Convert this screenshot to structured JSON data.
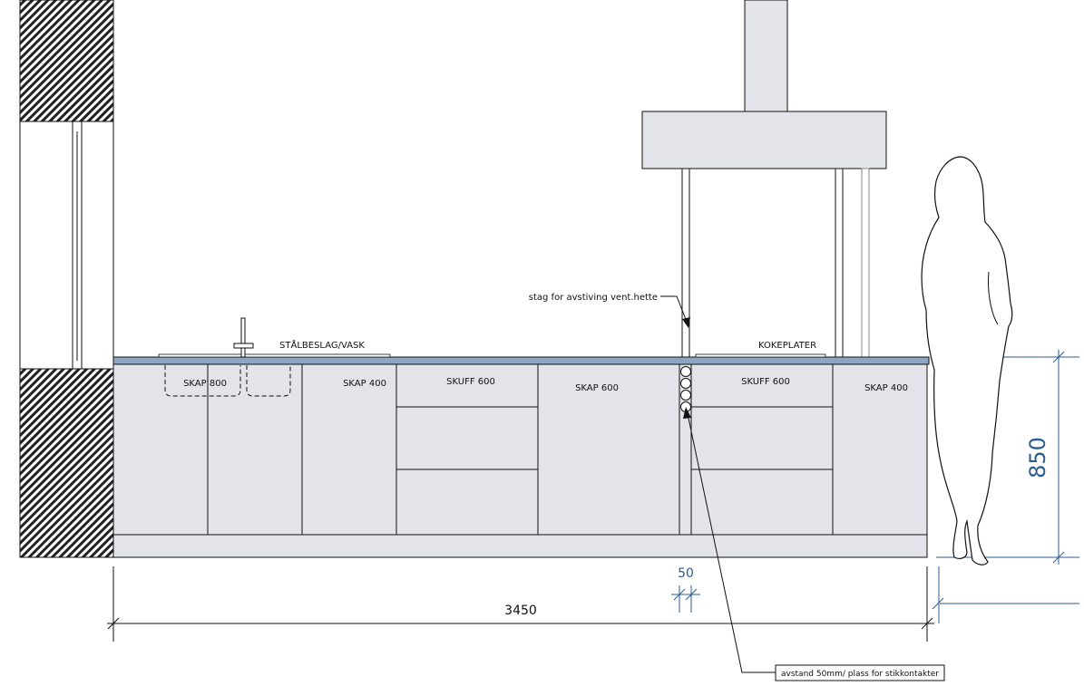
{
  "labels": {
    "stalbeslag_vask": "STÅLBESLAG/VASK",
    "kokeplater": "KOKEPLATER",
    "stag_note": "stag for avstiving vent.hette",
    "avstand_note": "avstand 50mm/ plass for stikkontakter"
  },
  "cabinets": {
    "skap800": "SKAP 800",
    "skap400_left": "SKAP 400",
    "skuff600_left": "SKUFF 600",
    "skap600": "SKAP 600",
    "skuff600_right": "SKUFF 600",
    "skap400_right": "SKAP 400"
  },
  "dimensions": {
    "total_width": "3450",
    "gap": "50",
    "height": "850"
  },
  "colors": {
    "line": "#111111",
    "cabinet_fill": "#e3e4e9",
    "countertop": "#8da6c3",
    "dimension_blue": "#2a5d8f"
  }
}
